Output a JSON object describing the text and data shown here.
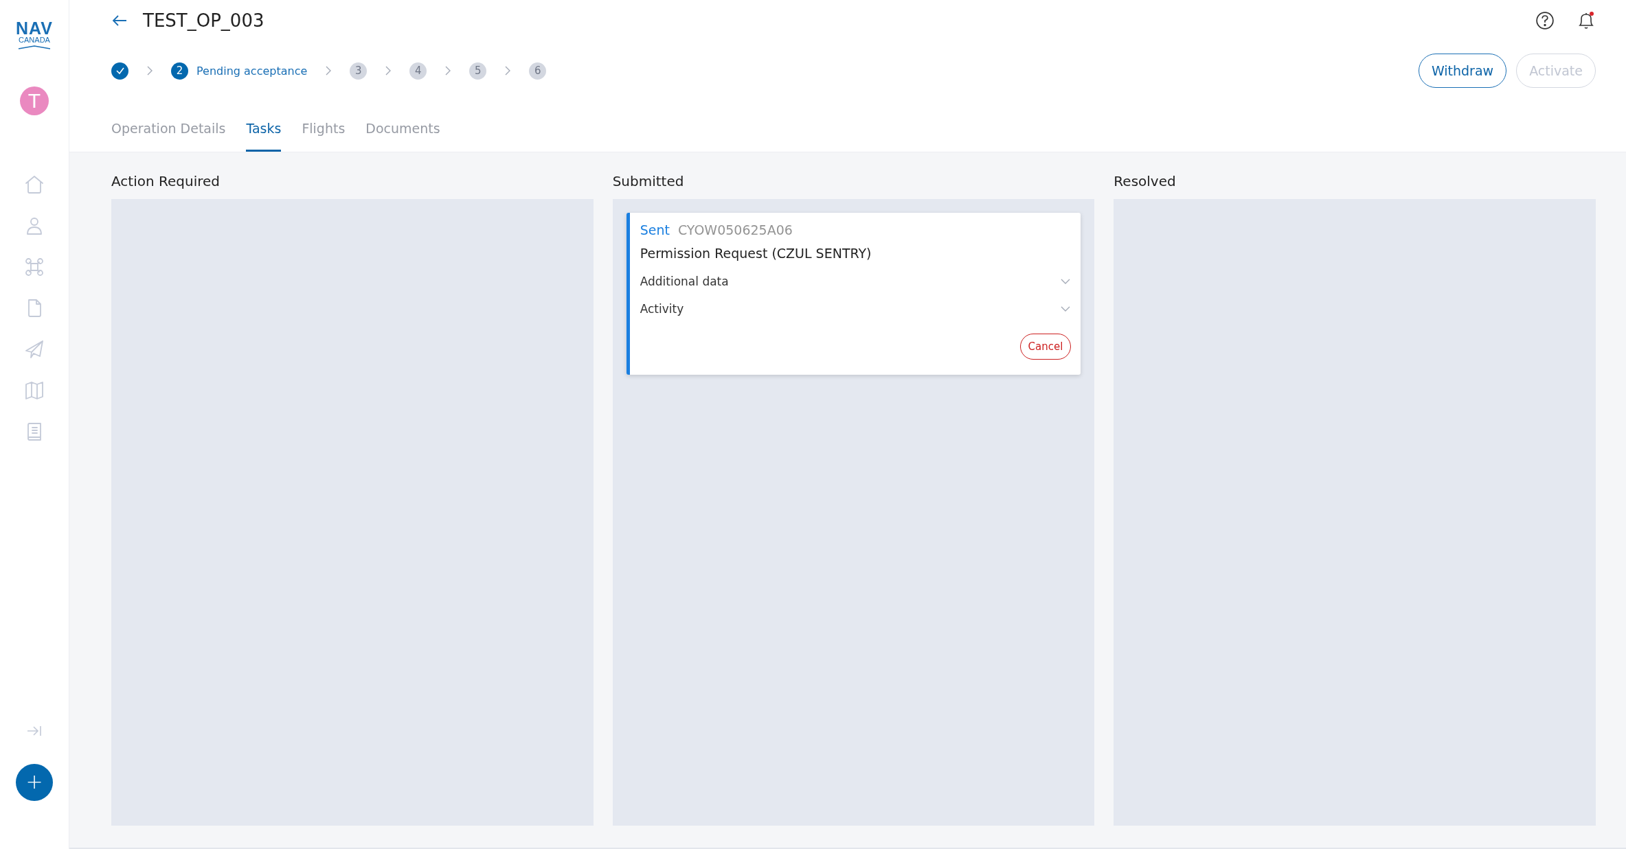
{
  "sidebar": {
    "logo": {
      "top": "NAV",
      "bottom": "CANADA"
    },
    "avatar": {
      "initial": "T"
    },
    "items": [
      {
        "kind": "home"
      },
      {
        "kind": "user"
      },
      {
        "kind": "drone"
      },
      {
        "kind": "document"
      },
      {
        "kind": "send"
      },
      {
        "kind": "map"
      },
      {
        "kind": "book"
      }
    ],
    "fab": {
      "symbol": "+"
    }
  },
  "header": {
    "title": "TEST_OP_003",
    "notifications_unread": true,
    "steps": [
      {
        "completed": true
      },
      {
        "completed": false,
        "active": true,
        "number": "2",
        "label": "Pending acceptance"
      },
      {
        "completed": false,
        "active": false,
        "number": "3"
      },
      {
        "completed": false,
        "active": false,
        "number": "4"
      },
      {
        "completed": false,
        "active": false,
        "number": "5"
      },
      {
        "completed": false,
        "active": false,
        "number": "6"
      }
    ],
    "buttons": [
      {
        "label": "Withdraw",
        "disabled": false
      },
      {
        "label": "Activate",
        "disabled": true
      }
    ],
    "tabs": [
      {
        "label": "Operation Details",
        "selected": false
      },
      {
        "label": "Tasks",
        "selected": true
      },
      {
        "label": "Flights",
        "selected": false
      },
      {
        "label": "Documents",
        "selected": false
      }
    ]
  },
  "columns": [
    {
      "title": "Action Required"
    },
    {
      "title": "Submitted",
      "cards": [
        {
          "status": "Sent",
          "reference": "CYOW050625A06",
          "title": "Permission Request (CZUL SENTRY)",
          "sections": [
            {
              "label": "Additional data",
              "expanded": false
            },
            {
              "label": "Activity",
              "expanded": false
            }
          ],
          "action": "Cancel"
        }
      ]
    },
    {
      "title": "Resolved"
    }
  ]
}
